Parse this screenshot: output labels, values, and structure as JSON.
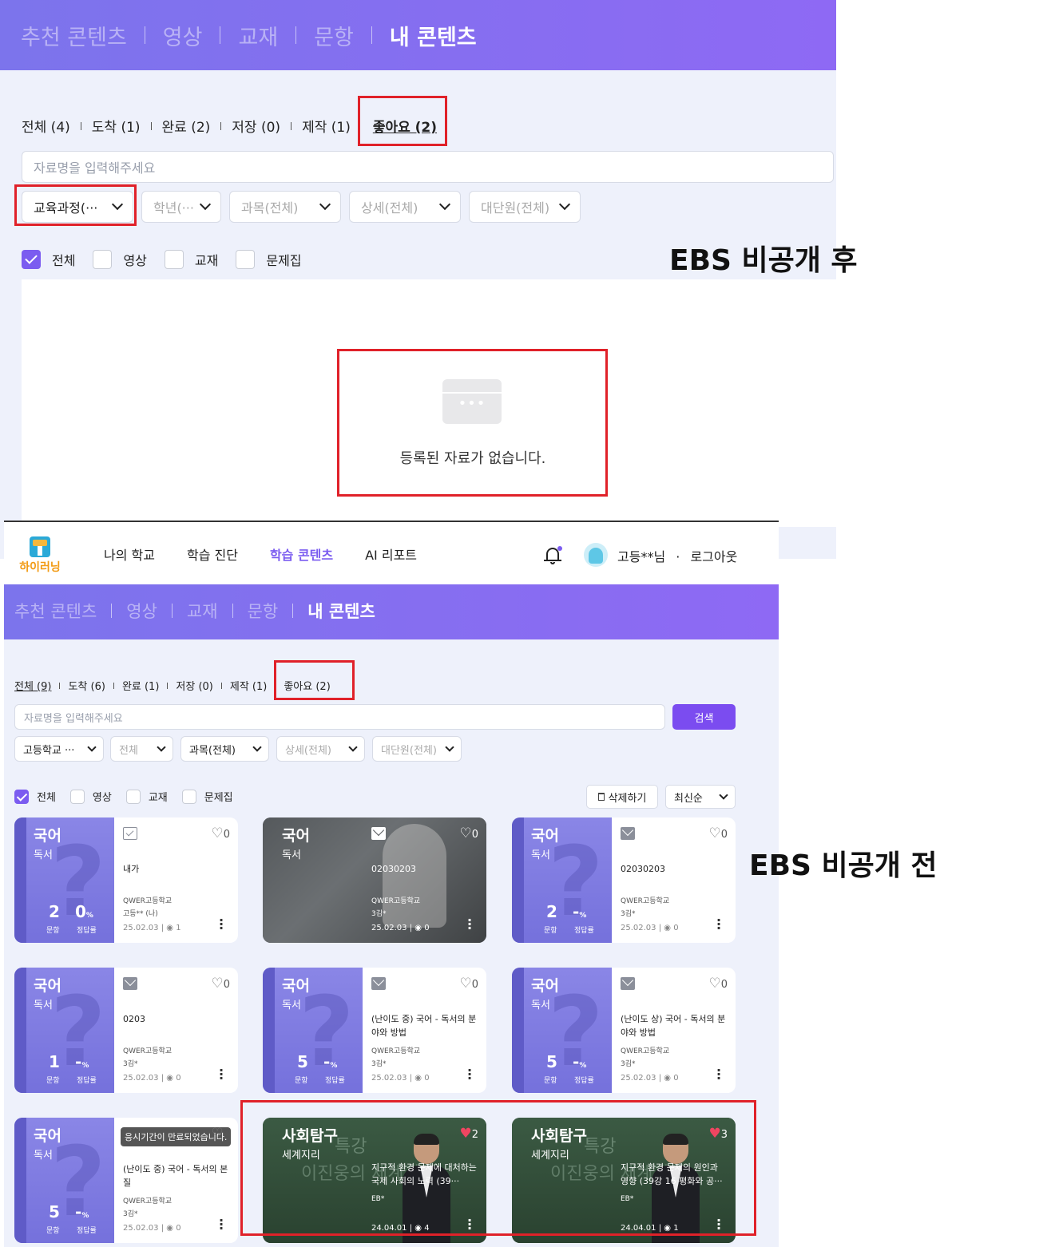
{
  "after": {
    "tabs": [
      "추천 콘텐츠",
      "영상",
      "교재",
      "문항",
      "내 콘텐츠"
    ],
    "active_tab": "내 콘텐츠",
    "filters": [
      {
        "label": "전체 (4)"
      },
      {
        "label": "도착 (1)"
      },
      {
        "label": "완료 (2)"
      },
      {
        "label": "저장 (0)"
      },
      {
        "label": "제작 (1)"
      },
      {
        "label": "좋아요 (2)"
      }
    ],
    "search_placeholder": "자료명을 입력해주세요",
    "selects": [
      "교육과정(···",
      "학년(···",
      "과목(전체)",
      "상세(전체)",
      "대단원(전체)"
    ],
    "checks": [
      {
        "label": "전체",
        "checked": true
      },
      {
        "label": "영상",
        "checked": false
      },
      {
        "label": "교재",
        "checked": false
      },
      {
        "label": "문제집",
        "checked": false
      }
    ],
    "empty_icon": "empty-folder-icon",
    "empty_message": "등록된 자료가 없습니다."
  },
  "label_after": "EBS 비공개 후",
  "label_before": "EBS 비공개 전",
  "before": {
    "logo_text": "하이러닝",
    "nav": [
      "나의 학교",
      "학습 진단",
      "학습 콘텐츠",
      "AI 리포트"
    ],
    "active_nav": "학습 콘텐츠",
    "user_name": "고등**님",
    "user_sep": "·",
    "logout": "로그아웃",
    "tabs": [
      "추천 콘텐츠",
      "영상",
      "교재",
      "문항",
      "내 콘텐츠"
    ],
    "filters": [
      {
        "label": "전체 (9)"
      },
      {
        "label": "도착 (6)"
      },
      {
        "label": "완료 (1)"
      },
      {
        "label": "저장 (0)"
      },
      {
        "label": "제작 (1)"
      },
      {
        "label": "좋아요 (2)"
      }
    ],
    "search_placeholder": "자료명을 입력해주세요",
    "search_button": "검색",
    "selects": [
      "고등학교 ···",
      "전체",
      "과목(전체)",
      "상세(전체)",
      "대단원(전체)"
    ],
    "checks": [
      {
        "label": "전체",
        "checked": true
      },
      {
        "label": "영상",
        "checked": false
      },
      {
        "label": "교재",
        "checked": false
      },
      {
        "label": "문제집",
        "checked": false
      }
    ],
    "delete_button": "삭제하기",
    "sort": "최신순",
    "cards": [
      {
        "subject": "국어",
        "sub": "독서",
        "count": "2",
        "rate": "0",
        "rate_unit": "%",
        "count_label": "문항",
        "rate_label": "정답률",
        "icon": "check-icon",
        "likes": "0",
        "title": "내가",
        "school": "QWER고등학교",
        "author": "고등** (나)",
        "date": "25.02.03",
        "views": "1",
        "kind": "quiz"
      },
      {
        "subject": "국어",
        "sub": "독서",
        "icon": "envelope-icon",
        "likes": "0",
        "title": "02030203",
        "school": "QWER고등학교",
        "author": "3김*",
        "date": "25.02.03",
        "views": "0",
        "kind": "photo"
      },
      {
        "subject": "국어",
        "sub": "독서",
        "count": "2",
        "rate": "-",
        "rate_unit": "%",
        "count_label": "문항",
        "rate_label": "정답률",
        "icon": "envelope-icon",
        "likes": "0",
        "title": "02030203",
        "school": "QWER고등학교",
        "author": "3김*",
        "date": "25.02.03",
        "views": "0",
        "kind": "quiz"
      },
      {
        "subject": "국어",
        "sub": "독서",
        "count": "1",
        "rate": "-",
        "rate_unit": "%",
        "count_label": "문항",
        "rate_label": "정답률",
        "icon": "envelope-icon",
        "likes": "0",
        "title": "0203",
        "school": "QWER고등학교",
        "author": "3김*",
        "date": "25.02.03",
        "views": "0",
        "kind": "quiz"
      },
      {
        "subject": "국어",
        "sub": "독서",
        "count": "5",
        "rate": "-",
        "rate_unit": "%",
        "count_label": "문항",
        "rate_label": "정답률",
        "icon": "envelope-icon",
        "likes": "0",
        "title": "(난이도 중) 국어 - 독서의 분야와 방법",
        "school": "QWER고등학교",
        "author": "3김*",
        "date": "25.02.03",
        "views": "0",
        "kind": "quiz"
      },
      {
        "subject": "국어",
        "sub": "독서",
        "count": "5",
        "rate": "-",
        "rate_unit": "%",
        "count_label": "문항",
        "rate_label": "정답률",
        "icon": "envelope-icon",
        "likes": "0",
        "title": "(난이도 상) 국어 - 독서의 분야와 방법",
        "school": "QWER고등학교",
        "author": "3김*",
        "date": "25.02.03",
        "views": "0",
        "kind": "quiz"
      },
      {
        "subject": "국어",
        "sub": "독서",
        "count": "5",
        "rate": "-",
        "rate_unit": "%",
        "count_label": "문항",
        "rate_label": "정답률",
        "tooltip": "응시기간이 만료되었습니다.",
        "likes": "0",
        "title": "(난이도 중) 국어 - 독서의 본질",
        "school": "QWER고등학교",
        "author": "3김*",
        "date": "25.02.03",
        "views": "0",
        "kind": "quiz"
      },
      {
        "subject": "사회탐구",
        "sub": "세계지리",
        "overlay1": "특강",
        "overlay2": "이진웅의 세계지리",
        "likes": "2",
        "title": "지구적 환경 문제에 대처하는 국제 사회의 노력 (39···",
        "author": "EB*",
        "date": "24.04.01",
        "views": "4",
        "kind": "video"
      },
      {
        "subject": "사회탐구",
        "sub": "세계지리",
        "overlay1": "특강",
        "overlay2": "이진웅의 세계지리",
        "likes": "3",
        "title": "지구적 환경 문제의 원인과 영향 (39강 16 평화와 공···",
        "author": "EB*",
        "date": "24.04.01",
        "views": "1",
        "kind": "video"
      }
    ]
  }
}
